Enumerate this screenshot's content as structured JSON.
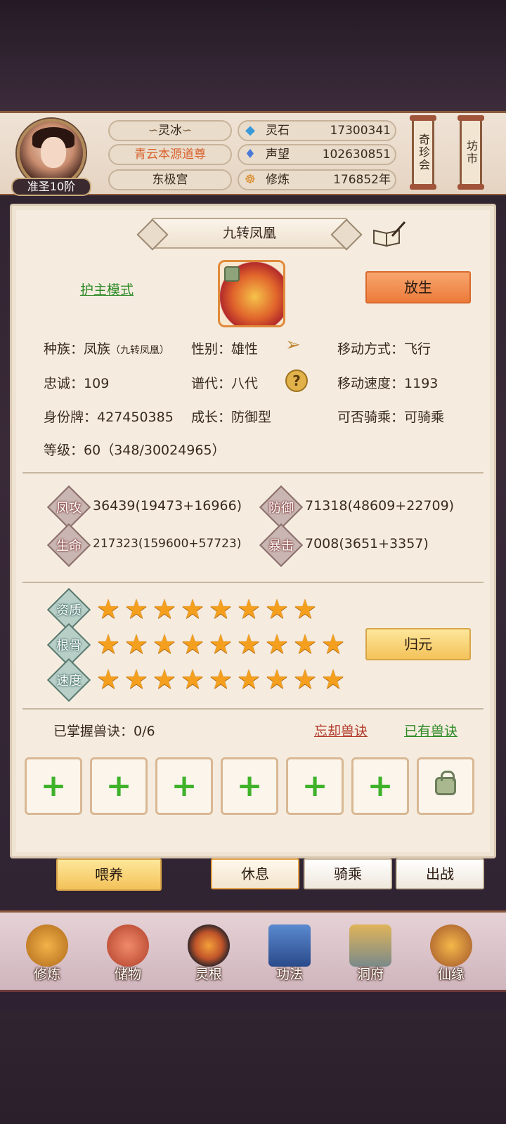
{
  "header": {
    "rank": "准圣10阶",
    "player_name": "灵冰",
    "title": "青云本源道尊",
    "sect": "东极宫",
    "resources": [
      {
        "icon": "spirit-stone-icon",
        "label": "灵石",
        "value": "17300341"
      },
      {
        "icon": "reputation-icon",
        "label": "声望",
        "value": "102630851"
      },
      {
        "icon": "meditation-icon",
        "label": "修炼",
        "value": "176852年"
      }
    ],
    "side_buttons": [
      "奇珍会",
      "坊市"
    ]
  },
  "pet": {
    "name": "九转凤凰",
    "mode_link": "护主模式",
    "release_button": "放生",
    "info": {
      "race_label": "种族：",
      "race": "凤族",
      "race_sub": "（九转凤凰）",
      "gender_label": "性别：",
      "gender": "雄性",
      "move_type_label": "移动方式：",
      "move_type": "飞行",
      "loyalty_label": "忠诚：",
      "loyalty": "109",
      "generation_label": "谱代：",
      "generation": "八代",
      "move_speed_label": "移动速度：",
      "move_speed": "1193",
      "id_label": "身份牌：",
      "id": "427450385",
      "growth_label": "成长：",
      "growth": "防御型",
      "rideable_label": "可否骑乘：",
      "rideable": "可骑乘",
      "level_label": "等级：",
      "level": "60（348/30024965）"
    },
    "stats": [
      {
        "badge": "凤攻",
        "value": "36439(19473+16966)"
      },
      {
        "badge": "防御",
        "value": "71318(48609+22709)"
      },
      {
        "badge": "生命",
        "value": "217323(159600+57723)"
      },
      {
        "badge": "暴击",
        "value": "7008(3651+3357)"
      }
    ],
    "attributes": [
      {
        "badge": "资质",
        "stars": 8
      },
      {
        "badge": "根骨",
        "stars": 9
      },
      {
        "badge": "速度",
        "stars": 9
      }
    ],
    "reset_button": "归元",
    "skills": {
      "mastered_label": "已掌握兽诀：0/6",
      "forget_link": "忘却兽诀",
      "owned_link": "已有兽诀",
      "slots": [
        "+",
        "+",
        "+",
        "+",
        "+",
        "+",
        "locked"
      ]
    }
  },
  "actions": {
    "feed": "喂养",
    "rest": "休息",
    "ride": "骑乘",
    "battle": "出战"
  },
  "nav": [
    {
      "label": "修炼",
      "icon": "cultivation-icon"
    },
    {
      "label": "储物",
      "icon": "storage-bag-icon"
    },
    {
      "label": "灵根",
      "icon": "spirit-root-icon"
    },
    {
      "label": "功法",
      "icon": "skill-book-icon"
    },
    {
      "label": "洞府",
      "icon": "cave-mansion-icon"
    },
    {
      "label": "仙缘",
      "icon": "immortal-fate-icon"
    }
  ],
  "colors": {
    "accent_orange": "#ec7a3a",
    "accent_gold": "#f4c25a",
    "link_green": "#2d8a26",
    "link_red": "#b23a2a",
    "star": "#f4a01e"
  }
}
